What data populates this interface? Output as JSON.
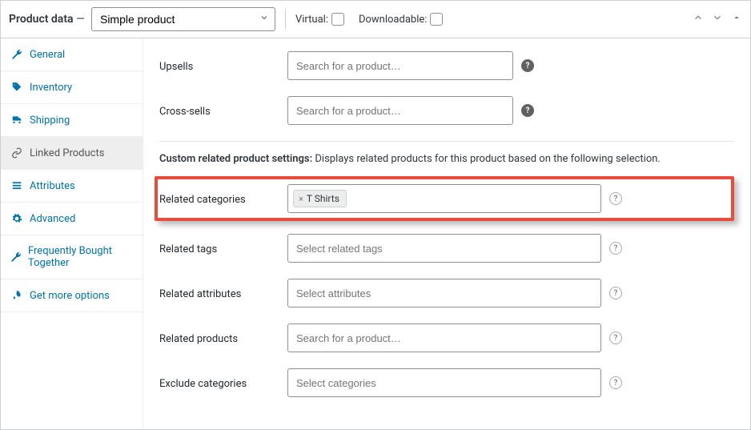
{
  "header": {
    "title": "Product data",
    "dash": "—",
    "product_type": "Simple product",
    "virtual_label": "Virtual:",
    "downloadable_label": "Downloadable:"
  },
  "sidebar": {
    "items": [
      {
        "label": "General",
        "icon": "wrench"
      },
      {
        "label": "Inventory",
        "icon": "tag"
      },
      {
        "label": "Shipping",
        "icon": "truck"
      },
      {
        "label": "Linked Products",
        "icon": "link"
      },
      {
        "label": "Attributes",
        "icon": "list"
      },
      {
        "label": "Advanced",
        "icon": "gear"
      },
      {
        "label": "Frequently Bought Together",
        "icon": "wrench"
      },
      {
        "label": "Get more options",
        "icon": "rocket"
      }
    ]
  },
  "fields": {
    "upsells": {
      "label": "Upsells",
      "placeholder": "Search for a product…"
    },
    "crosssells": {
      "label": "Cross-sells",
      "placeholder": "Search for a product…"
    },
    "section_heading_bold": "Custom related product settings:",
    "section_heading_rest": "Displays related products for this product based on the following selection.",
    "related_categories": {
      "label": "Related categories",
      "tag": "T Shirts"
    },
    "related_tags": {
      "label": "Related tags",
      "placeholder": "Select related tags"
    },
    "related_attributes": {
      "label": "Related attributes",
      "placeholder": "Select attributes"
    },
    "related_products": {
      "label": "Related products",
      "placeholder": "Search for a product…"
    },
    "exclude_categories": {
      "label": "Exclude categories",
      "placeholder": "Select categories"
    }
  }
}
